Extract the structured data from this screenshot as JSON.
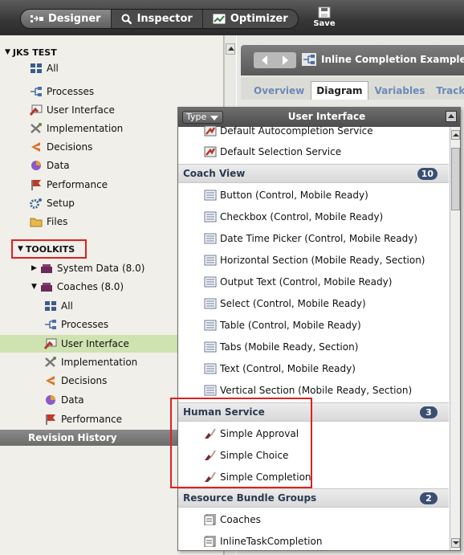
{
  "toolbar": {
    "designer": "Designer",
    "inspector": "Inspector",
    "optimizer": "Optimizer",
    "save": "Save"
  },
  "left_tree": {
    "root": "JKS TEST",
    "root_items": [
      "All",
      "Processes",
      "User Interface",
      "Implementation",
      "Decisions",
      "Data",
      "Performance",
      "Setup",
      "Files"
    ],
    "toolkits_label": "TOOLKITS",
    "system_data": "System Data (8.0)",
    "coaches": "Coaches (8.0)",
    "coach_items": [
      "All",
      "Processes",
      "User Interface",
      "Implementation",
      "Decisions",
      "Data",
      "Performance"
    ],
    "revision_history": "Revision History"
  },
  "editor": {
    "title": "Inline Completion Example",
    "tabs": [
      "Overview",
      "Diagram",
      "Variables",
      "Tracking"
    ]
  },
  "popup": {
    "type_label": "Type",
    "title": "User Interface",
    "top_items": [
      "Default Autocompletion Service",
      "Default Selection Service"
    ],
    "groups": [
      {
        "name": "Coach View",
        "count": "10",
        "items": [
          "Button  (Control, Mobile Ready)",
          "Checkbox  (Control, Mobile Ready)",
          "Date Time Picker  (Control, Mobile Ready)",
          "Horizontal Section  (Mobile Ready, Section)",
          "Output Text  (Control, Mobile Ready)",
          "Select  (Control, Mobile Ready)",
          "Table  (Control, Mobile Ready)",
          "Tabs  (Mobile Ready, Section)",
          "Text  (Control, Mobile Ready)",
          "Vertical Section  (Mobile Ready, Section)"
        ]
      },
      {
        "name": "Human Service",
        "count": "3",
        "items": [
          "Simple Approval",
          "Simple Choice",
          "Simple Completion"
        ]
      },
      {
        "name": "Resource Bundle Groups",
        "count": "2",
        "items": [
          "Coaches",
          "InlineTaskCompletion"
        ]
      }
    ]
  },
  "colors": {
    "highlight": "#e02020",
    "selected_row": "#cfe3b0",
    "group_badge": "#3b4f73"
  }
}
